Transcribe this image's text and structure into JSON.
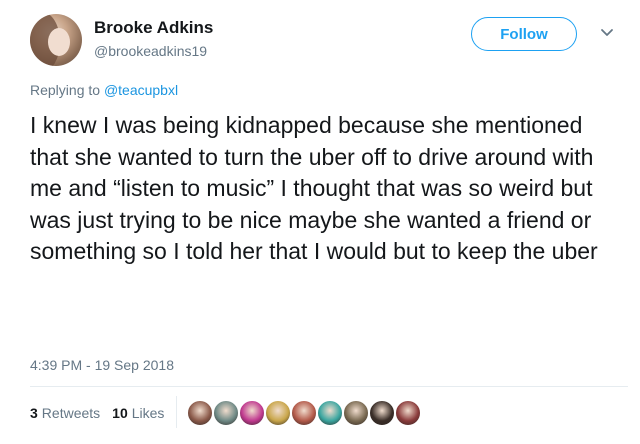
{
  "user": {
    "name": "Brooke Adkins",
    "handle": "@brookeadkins19"
  },
  "follow_label": "Follow",
  "replying": {
    "prefix": "Replying to",
    "mention": "@teacupbxl"
  },
  "tweet_text": "I knew I was being kidnapped because she mentioned that she wanted to turn the uber off to drive around with me and “listen to music” I thought that was so weird but was just trying to be nice maybe she wanted a friend or something so I told her that I would but to keep the uber",
  "timestamp": "4:39 PM - 19 Sep 2018",
  "stats": {
    "retweets_count": "3",
    "retweets_label": "Retweets",
    "likes_count": "10",
    "likes_label": "Likes"
  },
  "likers": [
    {
      "name": "liker-avatar-1",
      "color": "#8b5a4a"
    },
    {
      "name": "liker-avatar-2",
      "color": "#6f8a86"
    },
    {
      "name": "liker-avatar-3",
      "color": "#c0398f"
    },
    {
      "name": "liker-avatar-4",
      "color": "#c9a64a"
    },
    {
      "name": "liker-avatar-5",
      "color": "#b35a4a"
    },
    {
      "name": "liker-avatar-6",
      "color": "#3aa6a0"
    },
    {
      "name": "liker-avatar-7",
      "color": "#7a6a52"
    },
    {
      "name": "liker-avatar-8",
      "color": "#3a2e28"
    },
    {
      "name": "liker-avatar-9",
      "color": "#8a3b3b"
    }
  ]
}
